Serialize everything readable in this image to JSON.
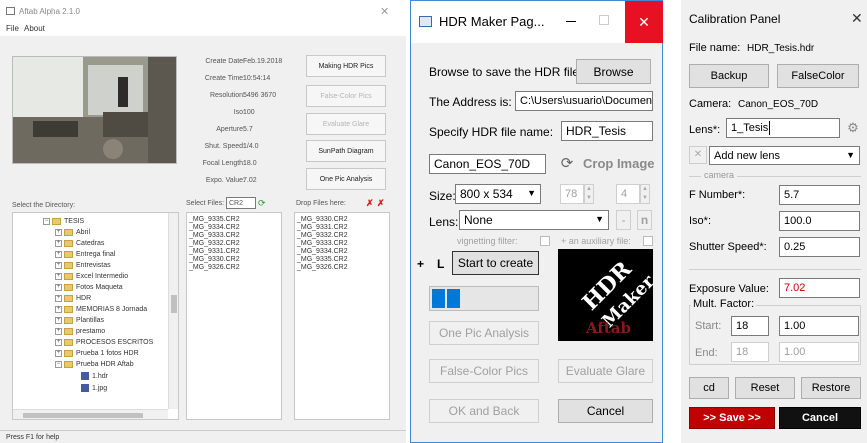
{
  "main_window": {
    "title": "Aftab Alpha 2.1.0",
    "close_glyph": "✕",
    "menu": [
      "File",
      "About"
    ],
    "info_labels": [
      "Create Date:",
      "Create Time:",
      "Resolution:",
      "Iso:",
      "Aperture:",
      "Shut. Speed:",
      "Focal Length:",
      "Expo. Value:"
    ],
    "info_values": [
      "Feb.19.2018",
      "10:54:14",
      "5496 3670",
      "100",
      "5.7",
      "1/4.0",
      "18.0",
      "7.02"
    ],
    "buttons": [
      "Making HDR Pics",
      "False-Color Pics",
      "Evaluate Glare",
      "SunPath Diagram",
      "One Pic Analysis"
    ],
    "directory_label": "Select the Directory:",
    "select_files_label": "Select Files:",
    "filter_value": "CR2",
    "drop_label": "Drop Files here:",
    "tree": [
      {
        "label": "TESIS",
        "level": 1,
        "expanded": true
      },
      {
        "label": "Abril",
        "level": 2
      },
      {
        "label": "Catedras",
        "level": 2
      },
      {
        "label": "Entrega final",
        "level": 2
      },
      {
        "label": "Entrevistas",
        "level": 2
      },
      {
        "label": "Excel Intermedio",
        "level": 2
      },
      {
        "label": "Fotos Maqueta",
        "level": 2
      },
      {
        "label": "HDR",
        "level": 2
      },
      {
        "label": "MEMORIAS 8 Jornada",
        "level": 2
      },
      {
        "label": "Plantillas",
        "level": 2
      },
      {
        "label": "prestamo",
        "level": 2
      },
      {
        "label": "PROCESOS ESCRITOS",
        "level": 2
      },
      {
        "label": "Prueba 1 fotos HDR",
        "level": 2
      },
      {
        "label": "Prueba HDR Aftab",
        "level": 2,
        "expanded": true
      },
      {
        "label": "1.hdr",
        "level": 3,
        "file": true
      },
      {
        "label": "1.jpg",
        "level": 3,
        "file": true
      }
    ],
    "files": [
      "_MG_9335.CR2",
      "_MG_9334.CR2",
      "_MG_9333.CR2",
      "_MG_9332.CR2",
      "_MG_9331.CR2",
      "_MG_9330.CR2",
      "_MG_9326.CR2"
    ],
    "dropped_files": [
      "_MG_9330.CR2",
      "_MG_9331.CR2",
      "_MG_9332.CR2",
      "_MG_9333.CR2",
      "_MG_9334.CR2",
      "_MG_9335.CR2",
      "_MG_9326.CR2"
    ],
    "status": "Press F1 for help"
  },
  "hdr_window": {
    "title": "HDR Maker Pag...",
    "browse_label": "Browse to save the HDR file:",
    "browse_button": "Browse",
    "address_label": "The Address is:",
    "address_value": "C:\\Users\\usuario\\Document",
    "name_label": "Specify HDR file name:",
    "name_value": "HDR_Tesis",
    "camera_value": "Canon_EOS_70D",
    "crop_button": "Crop Image",
    "size_label": "Size:",
    "size_value": "800 x 534",
    "crop_w": "78",
    "crop_h": "4",
    "lens_label": "Lens:",
    "lens_value": "None",
    "minus": "-",
    "n": "n",
    "vignetting_label": "vignetting filter:",
    "auxiliary_label": "+ an auxiliary file:",
    "plus": "+",
    "L": "L",
    "start_button": "Start to create",
    "logo_text_1": "HDR",
    "logo_text_2": "Maker",
    "logo_text_3": "Aftab",
    "one_pic_button": "One Pic Analysis",
    "false_color_button": "False-Color Pics",
    "evaluate_button": "Evaluate Glare",
    "ok_back_button": "OK and Back",
    "cancel_button": "Cancel"
  },
  "calibration": {
    "title": "Calibration Panel",
    "file_label": "File name:",
    "file_value": "HDR_Tesis.hdr",
    "backup_button": "Backup",
    "falsecolor_button": "FalseColor",
    "camera_label": "Camera:",
    "camera_value": "Canon_EOS_70D",
    "lens_label": "Lens*:",
    "lens_value": "1_Tesis",
    "add_lens_value": "Add new lens",
    "camera_group": "camera",
    "fnumber_label": "F Number*:",
    "fnumber_value": "5.7",
    "iso_label": "Iso*:",
    "iso_value": "100.0",
    "shutter_label": "Shutter Speed*:",
    "shutter_value": "0.25",
    "exposure_label": "Exposure Value:",
    "exposure_value": "7.02",
    "mult_label": "Mult. Factor:",
    "start_label": "Start:",
    "start_a": "18",
    "start_b": "1.00",
    "end_label": "End:",
    "end_a": "18",
    "end_b": "1.00",
    "cd_button": "cd",
    "reset_button": "Reset",
    "restore_button": "Restore",
    "save_button": ">> Save >>",
    "cancel_button": "Cancel"
  }
}
